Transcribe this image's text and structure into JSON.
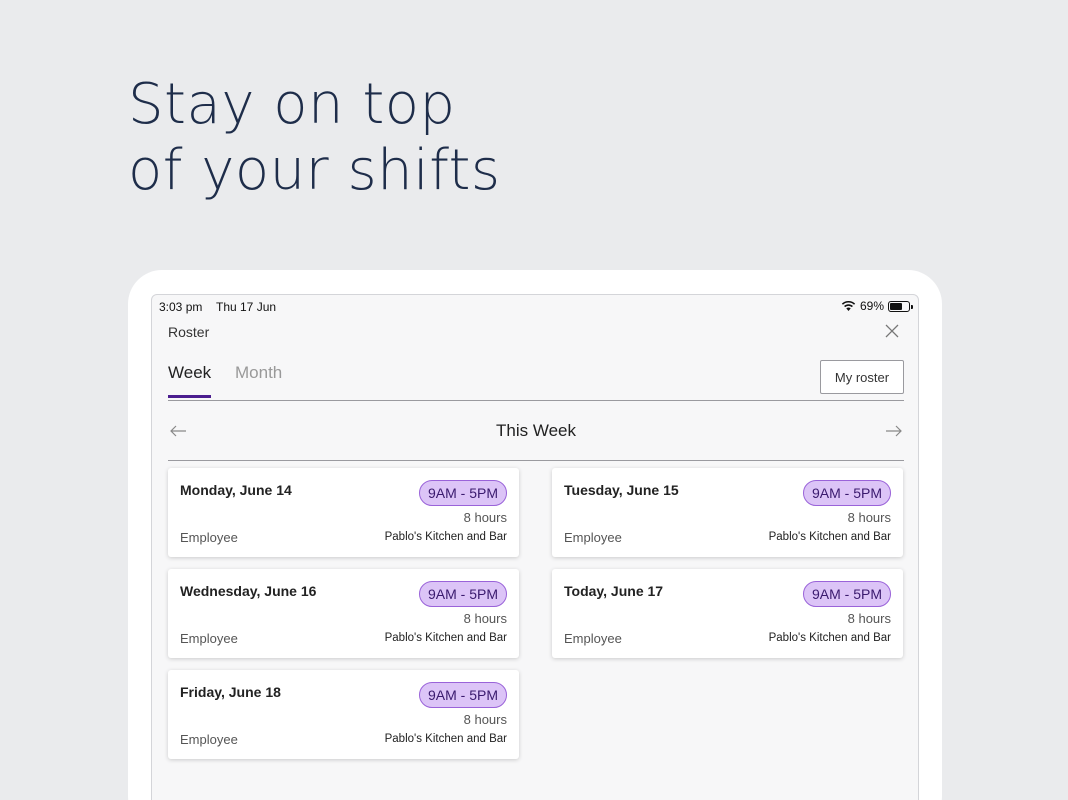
{
  "headline": {
    "line1": "Stay on top",
    "line2": "of your shifts"
  },
  "status_bar": {
    "time": "3:03 pm",
    "date": "Thu 17 Jun",
    "battery": "69%"
  },
  "page_title": "Roster",
  "tabs": [
    {
      "label": "Week",
      "active": true
    },
    {
      "label": "Month",
      "active": false
    }
  ],
  "my_roster_label": "My roster",
  "week_label": "This Week",
  "shifts": [
    {
      "day": "Monday, June 14",
      "time": "9AM - 5PM",
      "hours": "8 hours",
      "role": "Employee",
      "venue": "Pablo's Kitchen and Bar"
    },
    {
      "day": "Tuesday, June 15",
      "time": "9AM - 5PM",
      "hours": "8 hours",
      "role": "Employee",
      "venue": "Pablo's Kitchen and Bar"
    },
    {
      "day": "Wednesday, June 16",
      "time": "9AM - 5PM",
      "hours": "8 hours",
      "role": "Employee",
      "venue": "Pablo's Kitchen and Bar"
    },
    {
      "day": "Today, June 17",
      "time": "9AM - 5PM",
      "hours": "8 hours",
      "role": "Employee",
      "venue": "Pablo's Kitchen and Bar"
    },
    {
      "day": "Friday, June 18",
      "time": "9AM - 5PM",
      "hours": "8 hours",
      "role": "Employee",
      "venue": "Pablo's Kitchen and Bar"
    }
  ],
  "colors": {
    "accent": "#4b1d8f",
    "pill_bg": "#dcc4f7",
    "pill_border": "#9a63d9",
    "headline": "#1e2d4a"
  },
  "icons": [
    "wifi-icon",
    "battery-icon",
    "close-icon",
    "arrow-left-icon",
    "arrow-right-icon"
  ]
}
